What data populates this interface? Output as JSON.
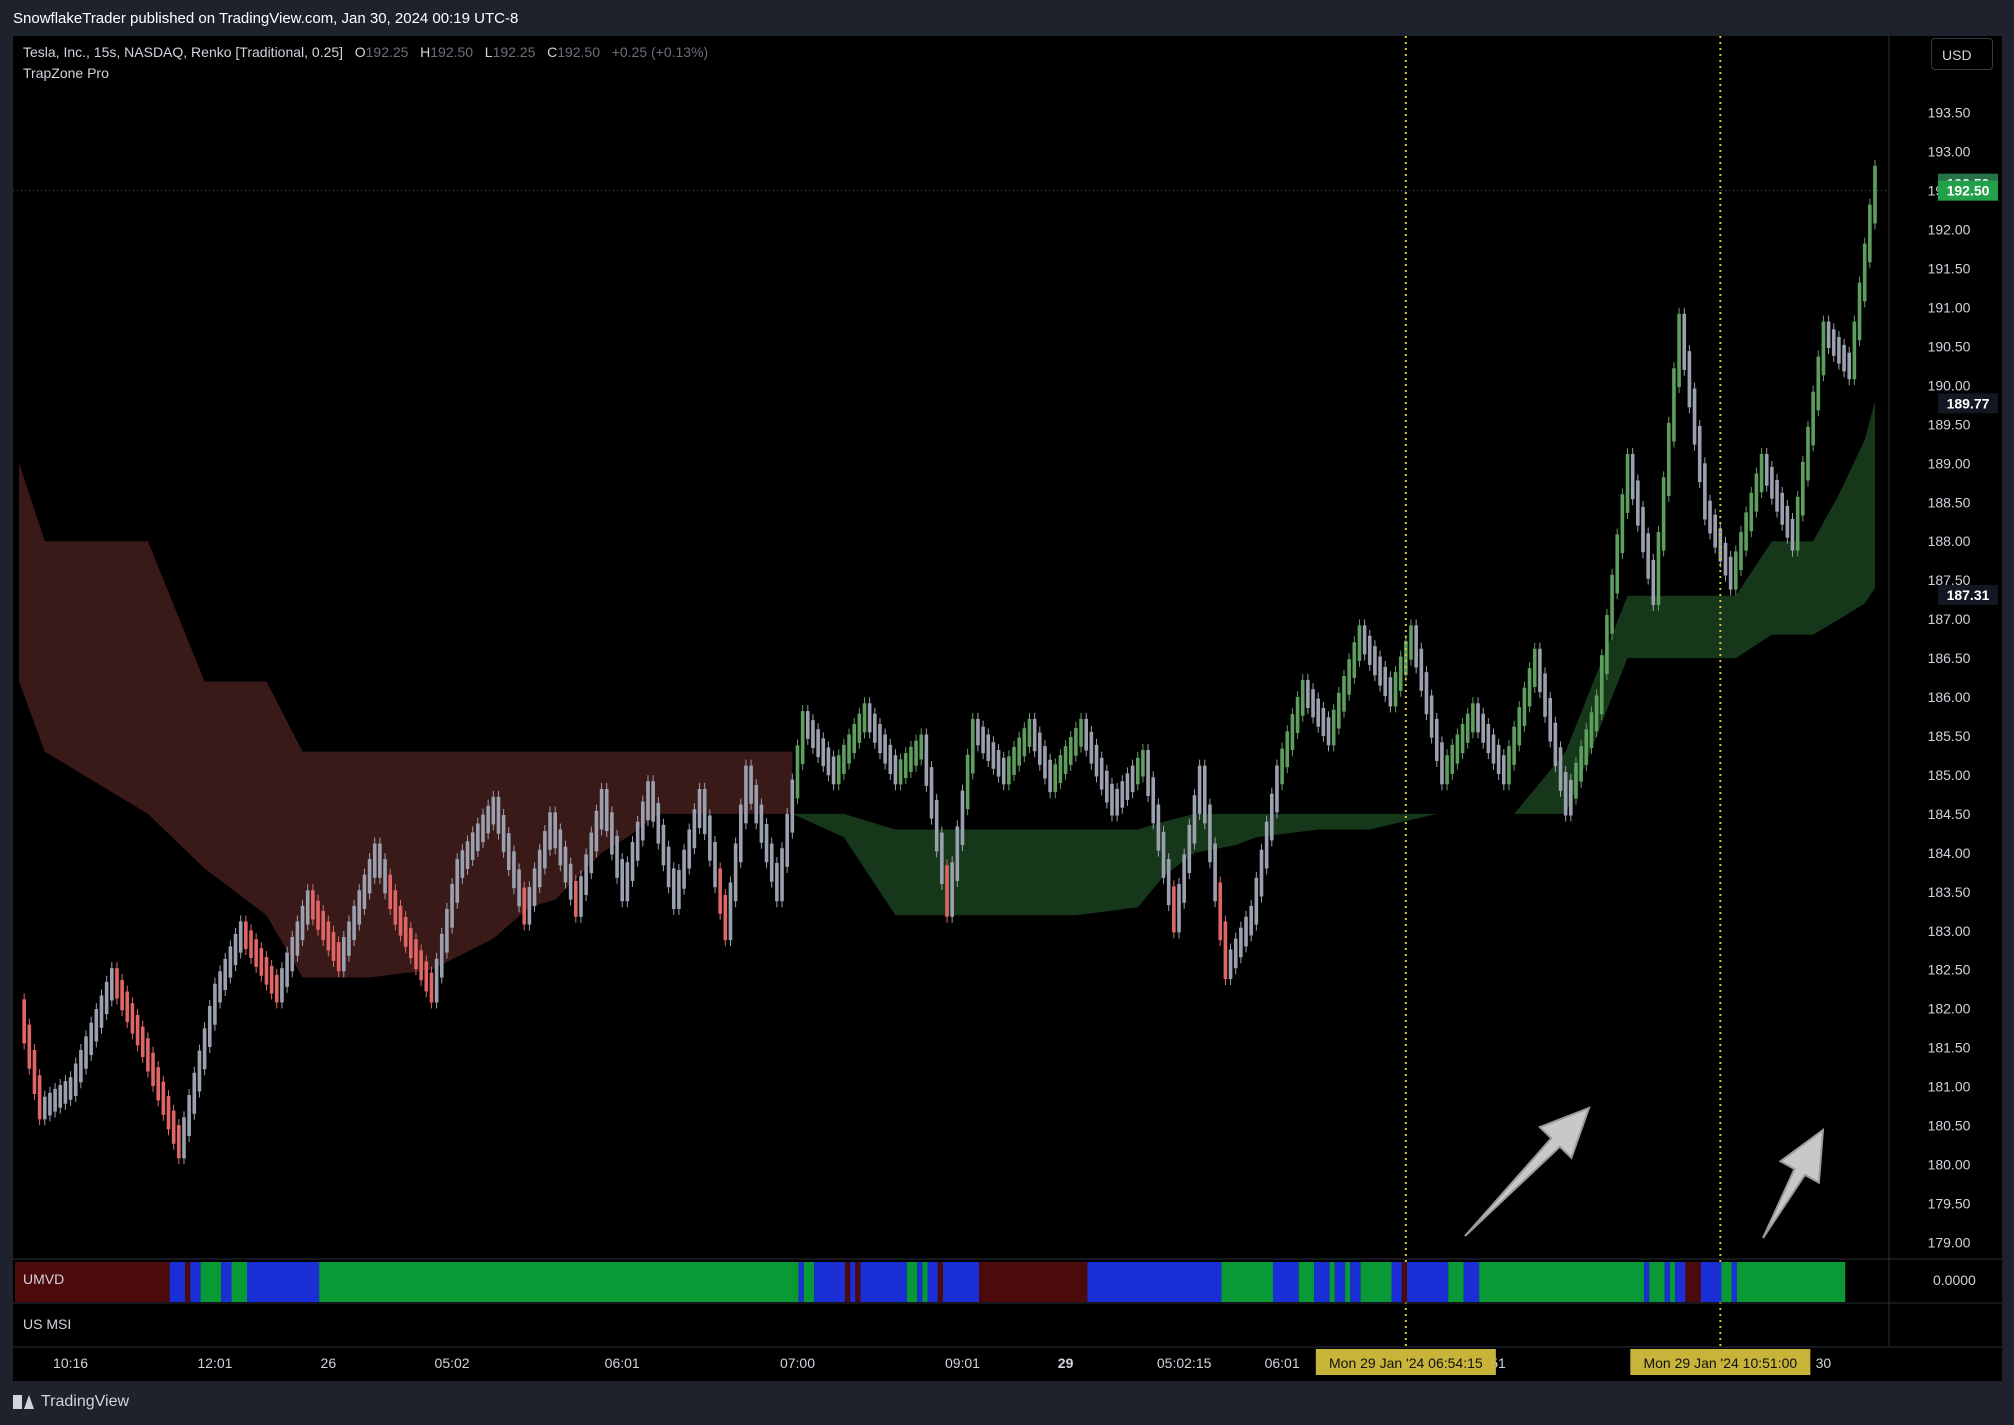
{
  "header": {
    "published": "SnowflakeTrader published on TradingView.com, Jan 30, 2024 00:19 UTC-8"
  },
  "legend": {
    "symbol": "Tesla, Inc., 15s, NASDAQ, Renko [Traditional, 0.25]",
    "o_key": "O",
    "o_val": "192.25",
    "h_key": "H",
    "h_val": "192.50",
    "l_key": "L",
    "l_val": "192.25",
    "c_key": "C",
    "c_val": "192.50",
    "change": "+0.25 (+0.13%)",
    "indicator": "TrapZone Pro"
  },
  "currency": "USD",
  "footer": {
    "brand": "TradingView"
  },
  "colors": {
    "bg": "#000000",
    "frame": "#1e222d",
    "up": "#5d9e5f",
    "down": "#e06666",
    "neutral": "#9aa0ad",
    "bear_zone": "#3d1a1a",
    "bull_zone": "#183d1c",
    "vline": "#d4c83a",
    "umvd_green": "#0a9a35",
    "umvd_blue": "#1a2fd6",
    "umvd_maroon": "#4d0a0a"
  },
  "chart_data": {
    "type": "line",
    "title": "",
    "y_axis_side": "right",
    "ylim": [
      178.8,
      194.1
    ],
    "y_ticks": [
      "193.50",
      "193.00",
      "192.50",
      "192.00",
      "191.50",
      "191.00",
      "190.50",
      "190.00",
      "189.50",
      "189.00",
      "188.50",
      "188.00",
      "187.50",
      "187.00",
      "186.50",
      "186.00",
      "185.50",
      "185.00",
      "184.50",
      "184.00",
      "183.50",
      "183.00",
      "182.50",
      "182.00",
      "181.50",
      "181.00",
      "180.50",
      "180.00",
      "179.50",
      "179.00"
    ],
    "price_labels": [
      {
        "text": "192.59",
        "value": 192.59,
        "color": "#26734a"
      },
      {
        "text": "192.50",
        "value": 192.5,
        "color": "#22a04a"
      },
      {
        "text": "189.77",
        "value": 189.77,
        "color": "#131722"
      },
      {
        "text": "187.31",
        "value": 187.31,
        "color": "#131722"
      }
    ],
    "current_price": 192.5,
    "x_ticks": [
      "10:16",
      "12:01",
      "26",
      "05:02",
      "06:01",
      "07:00",
      "09:01",
      "29",
      "05:02:15",
      "06:01",
      "07:51",
      "30"
    ],
    "bold_x_ticks": [
      "29"
    ],
    "crosshair_labels": [
      "Mon 29 Jan '24   06:54:15",
      "Mon 29 Jan '24   10:51:00"
    ],
    "bricks_count": 360,
    "series": [
      {
        "name": "",
        "type": "renko_path",
        "x": [
          0,
          4,
          10,
          18,
          24,
          31,
          38,
          43,
          50,
          56,
          62,
          69,
          73,
          80,
          85,
          92,
          98,
          103,
          108,
          113,
          117,
          122,
          127,
          132,
          137,
          141,
          147,
          152,
          158,
          164,
          170,
          175,
          180,
          185,
          191,
          196,
          200,
          206,
          212,
          218,
          224,
          229,
          234,
          239,
          244,
          249,
          254,
          260,
          266,
          270,
          276,
          282,
          288,
          294,
          300,
          306,
          312,
          317,
          322,
          327,
          332,
          338,
          344,
          350,
          355,
          360
        ],
        "values": [
          182.0,
          180.7,
          181.0,
          182.4,
          181.5,
          180.2,
          182.2,
          183.0,
          182.2,
          183.4,
          182.6,
          184.0,
          183.2,
          182.2,
          183.8,
          184.6,
          183.2,
          184.4,
          183.3,
          184.7,
          183.5,
          184.8,
          183.4,
          184.7,
          183.0,
          185.0,
          183.5,
          185.7,
          185.0,
          185.8,
          185.0,
          185.4,
          183.3,
          185.6,
          185.0,
          185.6,
          184.9,
          185.6,
          184.6,
          185.2,
          183.1,
          185.0,
          182.5,
          183.2,
          185.0,
          186.1,
          185.5,
          186.8,
          186.0,
          186.8,
          185.0,
          185.8,
          185.0,
          186.5,
          184.6,
          185.9,
          189.0,
          187.3,
          190.8,
          188.4,
          187.5,
          189.0,
          188.0,
          190.7,
          190.2,
          192.7
        ]
      },
      {
        "name": "",
        "type": "band",
        "x": [
          0,
          5,
          25,
          36,
          48,
          55,
          62,
          68,
          80,
          92,
          99,
          104,
          113,
          118,
          124,
          133,
          140,
          145,
          150
        ],
        "upper": [
          189.0,
          188.0,
          188.0,
          186.2,
          186.2,
          185.3,
          185.3,
          185.3,
          185.3,
          185.3,
          185.3,
          185.3,
          185.3,
          185.3,
          185.3,
          185.3,
          185.3,
          185.3,
          185.3
        ],
        "lower": [
          186.2,
          185.3,
          184.5,
          183.8,
          183.2,
          182.4,
          182.4,
          182.4,
          182.5,
          182.9,
          183.3,
          183.4,
          184.0,
          184.2,
          184.5,
          184.5,
          184.5,
          184.5,
          184.5
        ]
      },
      {
        "name": "",
        "type": "band",
        "x": [
          150,
          160,
          170,
          178,
          186,
          194,
          205,
          217,
          222,
          228,
          236,
          240,
          252,
          262,
          275,
          282,
          290,
          300,
          312,
          325,
          333,
          340,
          348,
          353,
          358,
          360
        ],
        "upper": [
          184.5,
          184.5,
          184.3,
          184.3,
          184.3,
          184.3,
          184.3,
          184.3,
          184.4,
          184.5,
          184.5,
          184.5,
          184.5,
          184.5,
          184.5,
          184.5,
          184.5,
          185.3,
          187.3,
          187.3,
          187.3,
          188.0,
          188.0,
          188.6,
          189.3,
          189.8
        ],
        "lower": [
          184.5,
          184.2,
          183.2,
          183.2,
          183.2,
          183.2,
          183.2,
          183.3,
          183.7,
          184.0,
          184.1,
          184.2,
          184.3,
          184.3,
          184.5,
          184.5,
          184.5,
          184.5,
          186.5,
          186.5,
          186.5,
          186.8,
          186.8,
          187.0,
          187.2,
          187.4
        ]
      }
    ],
    "vertical_lines_x": [
      269,
      330
    ],
    "indicator_panes": [
      {
        "name": "UMVD",
        "value": "0.0000",
        "segments": [
          {
            "from": 0,
            "to": 30,
            "color": "maroon"
          },
          {
            "from": 30,
            "to": 33,
            "color": "blue"
          },
          {
            "from": 33,
            "to": 34,
            "color": "maroon"
          },
          {
            "from": 34,
            "to": 36,
            "color": "blue"
          },
          {
            "from": 36,
            "to": 40,
            "color": "green"
          },
          {
            "from": 40,
            "to": 42,
            "color": "blue"
          },
          {
            "from": 42,
            "to": 45,
            "color": "green"
          },
          {
            "from": 45,
            "to": 59,
            "color": "blue"
          },
          {
            "from": 59,
            "to": 152,
            "color": "green"
          },
          {
            "from": 152,
            "to": 153,
            "color": "blue"
          },
          {
            "from": 153,
            "to": 155,
            "color": "green"
          },
          {
            "from": 155,
            "to": 161,
            "color": "blue"
          },
          {
            "from": 161,
            "to": 162,
            "color": "maroon"
          },
          {
            "from": 162,
            "to": 163,
            "color": "blue"
          },
          {
            "from": 163,
            "to": 164,
            "color": "maroon"
          },
          {
            "from": 164,
            "to": 173,
            "color": "blue"
          },
          {
            "from": 173,
            "to": 175,
            "color": "green"
          },
          {
            "from": 175,
            "to": 176,
            "color": "blue"
          },
          {
            "from": 176,
            "to": 177,
            "color": "green"
          },
          {
            "from": 177,
            "to": 179,
            "color": "blue"
          },
          {
            "from": 179,
            "to": 180,
            "color": "maroon"
          },
          {
            "from": 180,
            "to": 187,
            "color": "blue"
          },
          {
            "from": 187,
            "to": 208,
            "color": "maroon"
          },
          {
            "from": 208,
            "to": 234,
            "color": "blue"
          },
          {
            "from": 234,
            "to": 244,
            "color": "green"
          },
          {
            "from": 244,
            "to": 249,
            "color": "blue"
          },
          {
            "from": 249,
            "to": 252,
            "color": "green"
          },
          {
            "from": 252,
            "to": 255,
            "color": "blue"
          },
          {
            "from": 255,
            "to": 256,
            "color": "green"
          },
          {
            "from": 256,
            "to": 258,
            "color": "blue"
          },
          {
            "from": 258,
            "to": 259,
            "color": "green"
          },
          {
            "from": 259,
            "to": 261,
            "color": "blue"
          },
          {
            "from": 261,
            "to": 267,
            "color": "green"
          },
          {
            "from": 267,
            "to": 269,
            "color": "blue"
          },
          {
            "from": 269,
            "to": 270,
            "color": "maroon"
          },
          {
            "from": 270,
            "to": 278,
            "color": "blue"
          },
          {
            "from": 278,
            "to": 281,
            "color": "green"
          },
          {
            "from": 281,
            "to": 284,
            "color": "blue"
          },
          {
            "from": 284,
            "to": 316,
            "color": "green"
          },
          {
            "from": 316,
            "to": 317,
            "color": "blue"
          },
          {
            "from": 317,
            "to": 320,
            "color": "green"
          },
          {
            "from": 320,
            "to": 321,
            "color": "blue"
          },
          {
            "from": 321,
            "to": 322,
            "color": "green"
          },
          {
            "from": 322,
            "to": 324,
            "color": "blue"
          },
          {
            "from": 324,
            "to": 327,
            "color": "maroon"
          },
          {
            "from": 327,
            "to": 331,
            "color": "blue"
          },
          {
            "from": 331,
            "to": 333,
            "color": "green"
          },
          {
            "from": 333,
            "to": 334,
            "color": "blue"
          },
          {
            "from": 334,
            "to": 355,
            "color": "green"
          }
        ]
      },
      {
        "name": "US MSI",
        "value": ""
      }
    ]
  }
}
